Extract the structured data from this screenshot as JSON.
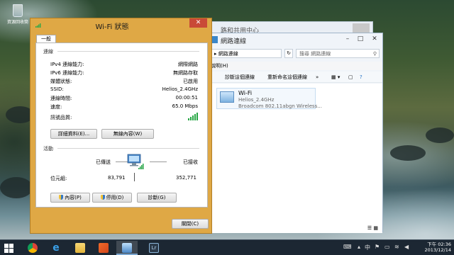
{
  "desktop": {
    "recycle_bin_label": "資源回收筒"
  },
  "back_window": {
    "title": "路和共用中心"
  },
  "network_connections": {
    "title": "網路連線",
    "minimize": "–",
    "maximize": "□",
    "close": "✕",
    "address": "▸ 網路連線",
    "search_placeholder": "搜尋 網路連線",
    "menu_help": "說明(H)",
    "cmd_diagnose": "診斷這個連線",
    "cmd_rename": "重新命名這個連線",
    "cmd_more": "»",
    "item": {
      "name": "Wi-Fi",
      "ssid": "Helios_2.4GHz",
      "device": "Broadcom 802.11abgn Wireless..."
    }
  },
  "wifi_status": {
    "title": "Wi-Fi 狀態",
    "close_glyph": "✕",
    "tab_general": "一般",
    "connection": {
      "heading": "連線",
      "rows": [
        {
          "label": "IPv4 連線能力:",
          "value": "網際網路"
        },
        {
          "label": "IPv6 連線能力:",
          "value": "無網路存取"
        },
        {
          "label": "媒體狀態:",
          "value": "已啟用"
        },
        {
          "label": "SSID:",
          "value": "Helios_2.4GHz"
        },
        {
          "label": "連線時間:",
          "value": "00:00:51"
        },
        {
          "label": "速度:",
          "value": "65.0 Mbps"
        }
      ],
      "signal_label": "訊號品質:",
      "signal_strength": 5,
      "signal_max": 5,
      "details_button": "詳細資料(E)...",
      "wireless_props_button": "無線內容(W)"
    },
    "activity": {
      "heading": "活動",
      "sent_label": "已傳送",
      "received_label": "已接收",
      "bytes_label": "位元組:",
      "bytes_sent": "83,791",
      "bytes_received": "352,771"
    },
    "properties_button": "內容(P)",
    "disable_button": "停用(D)",
    "diagnose_button": "診斷(G)",
    "close_button": "關閉(C)"
  },
  "taskbar": {
    "ime": "中",
    "time": "下午 02:36",
    "date": "2013/12/14",
    "lr_label": "Lr"
  },
  "colors": {
    "dialog_frame": "#dfa845",
    "close_red": "#c94a37",
    "signal_green": "#27a745",
    "taskbar": "#1c2733"
  }
}
